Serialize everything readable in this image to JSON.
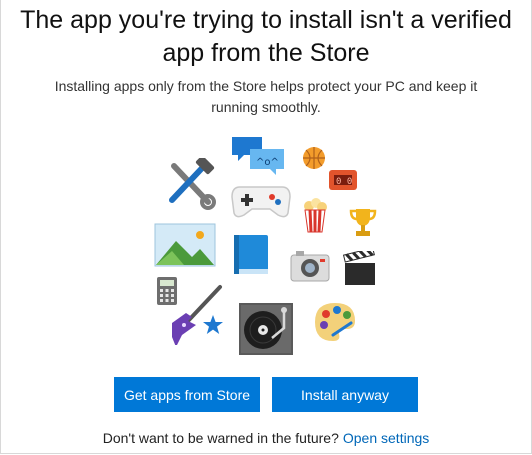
{
  "dialog": {
    "title": "The app you're trying to install isn't a verified app from the Store",
    "description": "Installing apps only from the Store helps protect your PC and keep it running smoothly.",
    "primary_button": "Get apps from Store",
    "secondary_button": "Install anyway",
    "footer_text": "Don't want to be warned in the future?",
    "footer_link": "Open settings",
    "accent_color": "#0078d7",
    "link_color": "#0067b8"
  },
  "icons": [
    "tools-icon",
    "chat-icon",
    "basketball-icon",
    "scoreboard-icon",
    "gamepad-icon",
    "popcorn-icon",
    "trophy-icon",
    "photo-icon",
    "book-icon",
    "camera-icon",
    "clapperboard-icon",
    "calculator-icon",
    "guitar-icon",
    "star-icon",
    "turntable-icon",
    "palette-icon"
  ]
}
